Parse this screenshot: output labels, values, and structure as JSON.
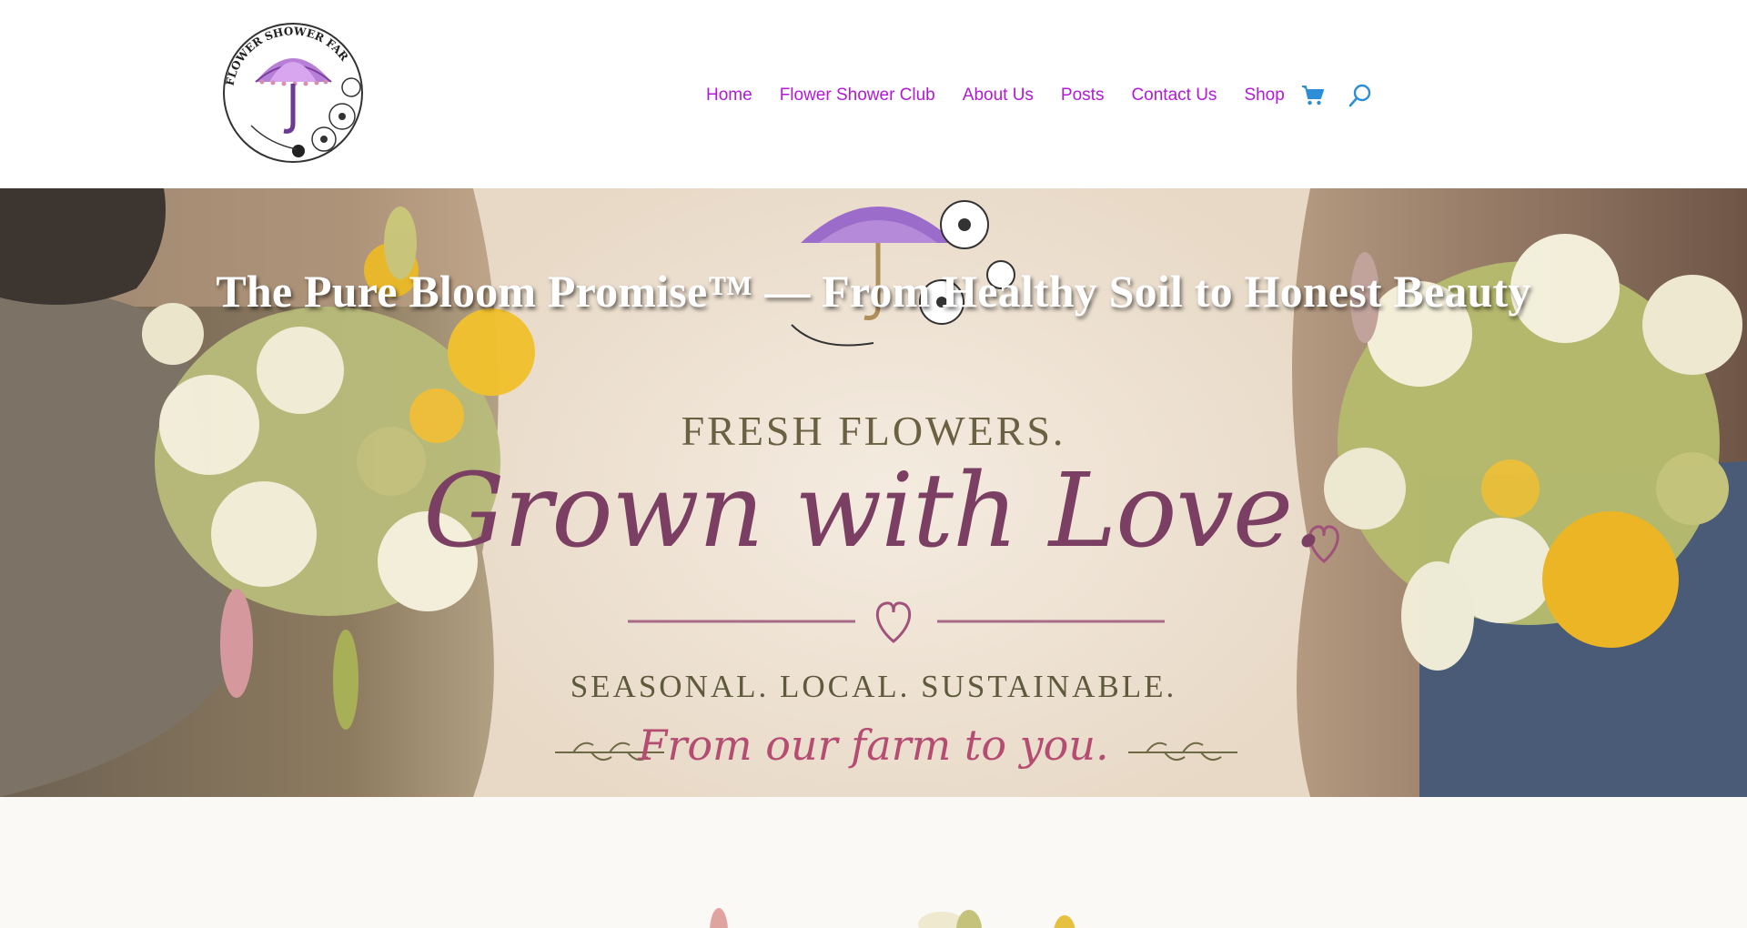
{
  "logo": {
    "alt_text": "FLOWER SHOWER FARM"
  },
  "nav": {
    "items": [
      {
        "label": "Home"
      },
      {
        "label": "Flower Shower Club"
      },
      {
        "label": "About Us"
      },
      {
        "label": "Posts"
      },
      {
        "label": "Contact Us"
      },
      {
        "label": "Shop"
      }
    ],
    "cart_icon": "shopping-cart-icon",
    "search_icon": "search-icon"
  },
  "hero": {
    "title": "The Pure Bloom Promise™ — From Healthy Soil to Honest Beauty",
    "banner": {
      "line1": "FRESH FLOWERS.",
      "line2": "Grown with Love.",
      "line3": "SEASONAL. LOCAL. SUSTAINABLE.",
      "line4": "From our farm to you."
    }
  },
  "colors": {
    "nav_link": "#b21ad6",
    "search_icon": "#2b8ed6",
    "cart_icon": "#2b8ed6",
    "banner_plum": "#7b3f63",
    "banner_pink": "#b54d73",
    "banner_olive": "#6b6142"
  }
}
